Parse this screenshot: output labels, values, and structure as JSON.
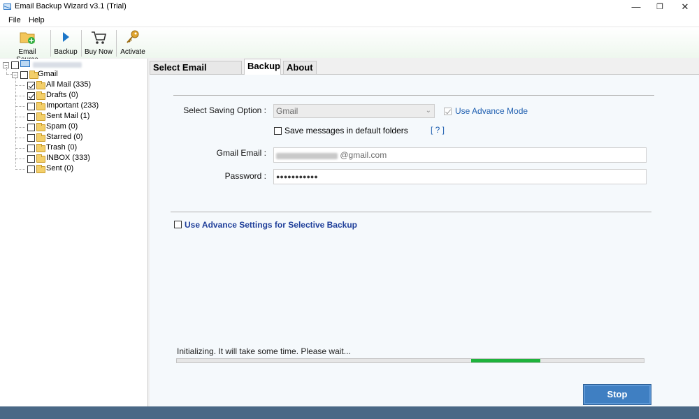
{
  "window": {
    "title": "Email Backup Wizard v3.1 (Trial)",
    "minimize": "—",
    "restore": "❐",
    "close": "✕"
  },
  "menu": [
    "File",
    "Help"
  ],
  "toolbar": {
    "email_source": "Email Source",
    "backup": "Backup",
    "buy_now": "Buy Now",
    "activate": "Activate"
  },
  "tree": {
    "account": "Gmail",
    "folders": [
      {
        "label": "All Mail (335)",
        "checked": true
      },
      {
        "label": "Drafts (0)",
        "checked": true
      },
      {
        "label": "Important (233)",
        "checked": false
      },
      {
        "label": "Sent Mail (1)",
        "checked": false
      },
      {
        "label": "Spam (0)",
        "checked": false
      },
      {
        "label": "Starred (0)",
        "checked": false
      },
      {
        "label": "Trash (0)",
        "checked": false
      },
      {
        "label": "INBOX (333)",
        "checked": false
      },
      {
        "label": "Sent (0)",
        "checked": false
      }
    ]
  },
  "tabs": [
    "Select Email Source",
    "Backup",
    "About"
  ],
  "backup": {
    "saving_option_label": "Select Saving Option :",
    "saving_option_value": "Gmail",
    "advance_mode_label": "Use Advance Mode",
    "default_folders_label": "Save messages in default folders",
    "help_link": "[ ? ]",
    "gmail_email_label": "Gmail Email :",
    "gmail_email_domain": "@gmail.com",
    "password_label": "Password :",
    "password_value": "●●●●●●●●●●●",
    "advance_settings_label": "Use Advance Settings for Selective Backup",
    "status_text": "Initializing. It will take some time. Please wait...",
    "stop_label": "Stop"
  },
  "colors": {
    "accent_blue": "#1f5fb0",
    "progress_green": "#1eb33c",
    "stop_button": "#3f7fc2"
  }
}
